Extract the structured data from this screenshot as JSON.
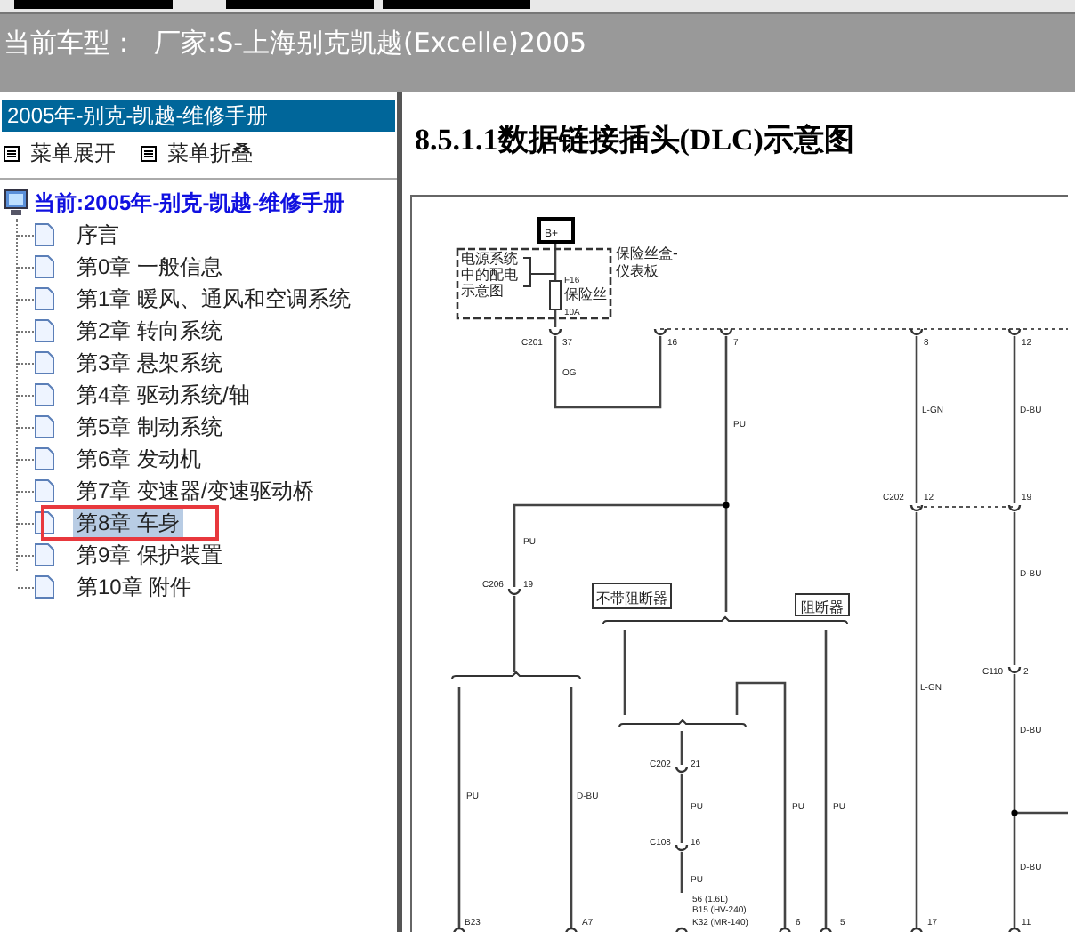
{
  "header": {
    "car_model": "当前车型：  厂家:S-上海别克凯越(Excelle)2005"
  },
  "sidebar": {
    "title": "2005年-别克-凯越-维修手册",
    "menu": [
      {
        "label": "菜单展开"
      },
      {
        "label": "菜单折叠"
      }
    ],
    "tree": {
      "label": "当前:2005年-别克-凯越-维修手册",
      "children": [
        {
          "label": "序言",
          "selected": false,
          "marked": false
        },
        {
          "label": "第0章 一般信息",
          "selected": false,
          "marked": false
        },
        {
          "label": "第1章 暖风、通风和空调系统",
          "selected": false,
          "marked": false
        },
        {
          "label": "第2章 转向系统",
          "selected": false,
          "marked": false
        },
        {
          "label": "第3章 悬架系统",
          "selected": false,
          "marked": false
        },
        {
          "label": "第4章 驱动系统/轴",
          "selected": false,
          "marked": false
        },
        {
          "label": "第5章 制动系统",
          "selected": false,
          "marked": false
        },
        {
          "label": "第6章 发动机",
          "selected": false,
          "marked": false
        },
        {
          "label": "第7章 变速器/变速驱动桥",
          "selected": false,
          "marked": false
        },
        {
          "label": "第8章 车身",
          "selected": true,
          "marked": true
        },
        {
          "label": "第9章 保护装置",
          "selected": false,
          "marked": false
        },
        {
          "label": "第10章 附件",
          "selected": false,
          "marked": false
        }
      ]
    }
  },
  "content": {
    "title": "8.5.1.1数据链接插头(DLC)示意图",
    "diagram": {
      "labels": [
        "B+",
        "电源系统",
        "中的配电",
        "示意图",
        "保险丝盒-",
        "仪表板",
        "F16",
        "保险丝",
        "10A",
        "C201",
        "37",
        "OG",
        "16",
        "7",
        "PU",
        "PU",
        "C206",
        "19",
        "PU",
        "D-BU",
        "B23",
        "A7",
        "不带阻断器",
        "阻断器",
        "C202",
        "21",
        "PU",
        "C108",
        "16",
        "PU",
        "56 (1.6L)",
        "B15 (HV-240)",
        "K32 (MR-140)",
        "PU",
        "PU",
        "6",
        "5",
        "8",
        "L-GN",
        "C202",
        "12",
        "L-GN",
        "17",
        "12",
        "D-BU",
        "19",
        "D-BU",
        "C110",
        "2",
        "D-BU",
        "D-BU",
        "11"
      ]
    }
  }
}
